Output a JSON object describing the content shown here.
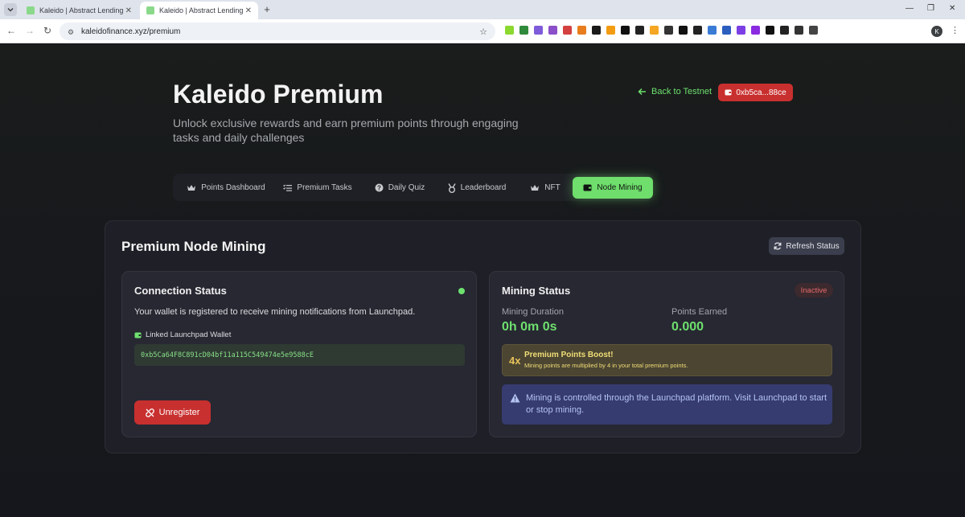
{
  "browser": {
    "tabs": [
      {
        "title": "Kaleido | Abstract Lending",
        "active": false
      },
      {
        "title": "Kaleido | Abstract Lending",
        "active": true
      }
    ],
    "url": "kaleidofinance.xyz/premium",
    "profile_initial": "K",
    "extension_colors": [
      "#8bd830",
      "#2f8a3b",
      "#7e5bd8",
      "#8b4fc9",
      "#d43f3f",
      "#e87d1e",
      "#1a1a1a",
      "#f39c12",
      "#111111",
      "#222222",
      "#f5a623",
      "#333333",
      "#111111",
      "#222222",
      "#3a7bd5",
      "#2c5ebf",
      "#7b3fe4",
      "#8a2be2",
      "#111111",
      "#222222",
      "#333333",
      "#444444"
    ]
  },
  "hero": {
    "title": "Kaleido Premium",
    "subtitle": "Unlock exclusive rewards and earn premium points through engaging tasks and daily challenges"
  },
  "header_actions": {
    "back_label": "Back to Testnet",
    "wallet_short": "0xb5ca...88ce"
  },
  "nav_tabs": [
    {
      "label": "Points Dashboard",
      "icon": "crown-icon",
      "active": false
    },
    {
      "label": "Premium Tasks",
      "icon": "list-icon",
      "active": false
    },
    {
      "label": "Daily Quiz",
      "icon": "question-icon",
      "active": false
    },
    {
      "label": "Leaderboard",
      "icon": "medal-icon",
      "active": false
    },
    {
      "label": "NFT",
      "icon": "crown-icon",
      "active": false
    },
    {
      "label": "Node Mining",
      "icon": "wallet-icon",
      "active": true
    }
  ],
  "panel": {
    "title": "Premium Node Mining",
    "refresh_label": "Refresh Status"
  },
  "connection": {
    "title": "Connection Status",
    "status_color": "#6ee06e",
    "description": "Your wallet is registered to receive mining notifications from Launchpad.",
    "linked_label": "Linked Launchpad Wallet",
    "wallet_address": "0xb5Ca64F8C891cD04bf11a115C549474e5e9588cE",
    "unregister_label": "Unregister"
  },
  "mining": {
    "title": "Mining Status",
    "badge": "Inactive",
    "duration_label": "Mining Duration",
    "duration_value": "0h 0m 0s",
    "points_label": "Points Earned",
    "points_value": "0.000",
    "boost_multiplier": "4x",
    "boost_title": "Premium Points Boost!",
    "boost_desc": "Mining points are multiplied by 4 in your total premium points.",
    "info_text": "Mining is controlled through the Launchpad platform. Visit Launchpad to start or stop mining."
  },
  "colors": {
    "accent_green": "#6fde6c",
    "danger_red": "#c8302f",
    "panel_bg": "#1f2027",
    "card_bg": "#272832"
  }
}
